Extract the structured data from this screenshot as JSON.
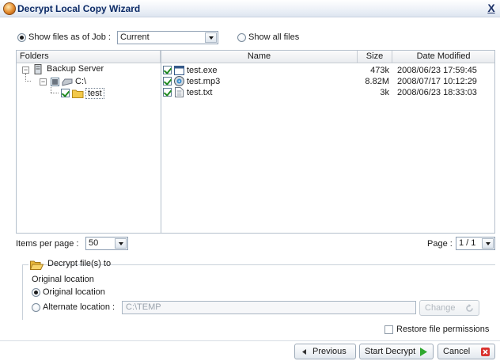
{
  "window": {
    "title": "Decrypt Local Copy Wizard",
    "close_label": "X"
  },
  "view": {
    "by_job_label": "Show files as of Job :",
    "job_value": "Current",
    "all_files_label": "Show all files"
  },
  "tree": {
    "header": "Folders",
    "nodes": [
      {
        "label": "Backup Server",
        "level": 0
      },
      {
        "label": "C:\\",
        "level": 1
      },
      {
        "label": "test",
        "level": 2
      }
    ]
  },
  "files": {
    "headers": {
      "name": "Name",
      "size": "Size",
      "date": "Date Modified"
    },
    "rows": [
      {
        "name": "test.exe",
        "size": "473k",
        "date": "2008/06/23 17:59:45",
        "icon": "exe-window-icon"
      },
      {
        "name": "test.mp3",
        "size": "8.82M",
        "date": "2008/07/17 10:12:29",
        "icon": "audio-cd-icon"
      },
      {
        "name": "test.txt",
        "size": "3k",
        "date": "2008/06/23 18:33:03",
        "icon": "text-document-icon"
      }
    ]
  },
  "paging": {
    "items_per_page_label": "Items per page :",
    "items_per_page_value": "50",
    "page_label": "Page :",
    "page_value": "1 / 1"
  },
  "decrypt": {
    "group_title": "Decrypt file(s) to",
    "current_location_label": "Original location",
    "original_option": "Original location",
    "alternate_option": "Alternate location :",
    "alternate_path": "C:\\TEMP",
    "change_label": "Change"
  },
  "restore_permissions_label": "Restore file permissions",
  "buttons": {
    "previous": "Previous",
    "start": "Start Decrypt",
    "cancel": "Cancel"
  },
  "colors": {
    "title_text": "#0b2a66",
    "check": "#1f8a1f",
    "cancel_icon": "#d9322e",
    "start_icon": "#2fa82f",
    "folder": "#f3c94a"
  }
}
